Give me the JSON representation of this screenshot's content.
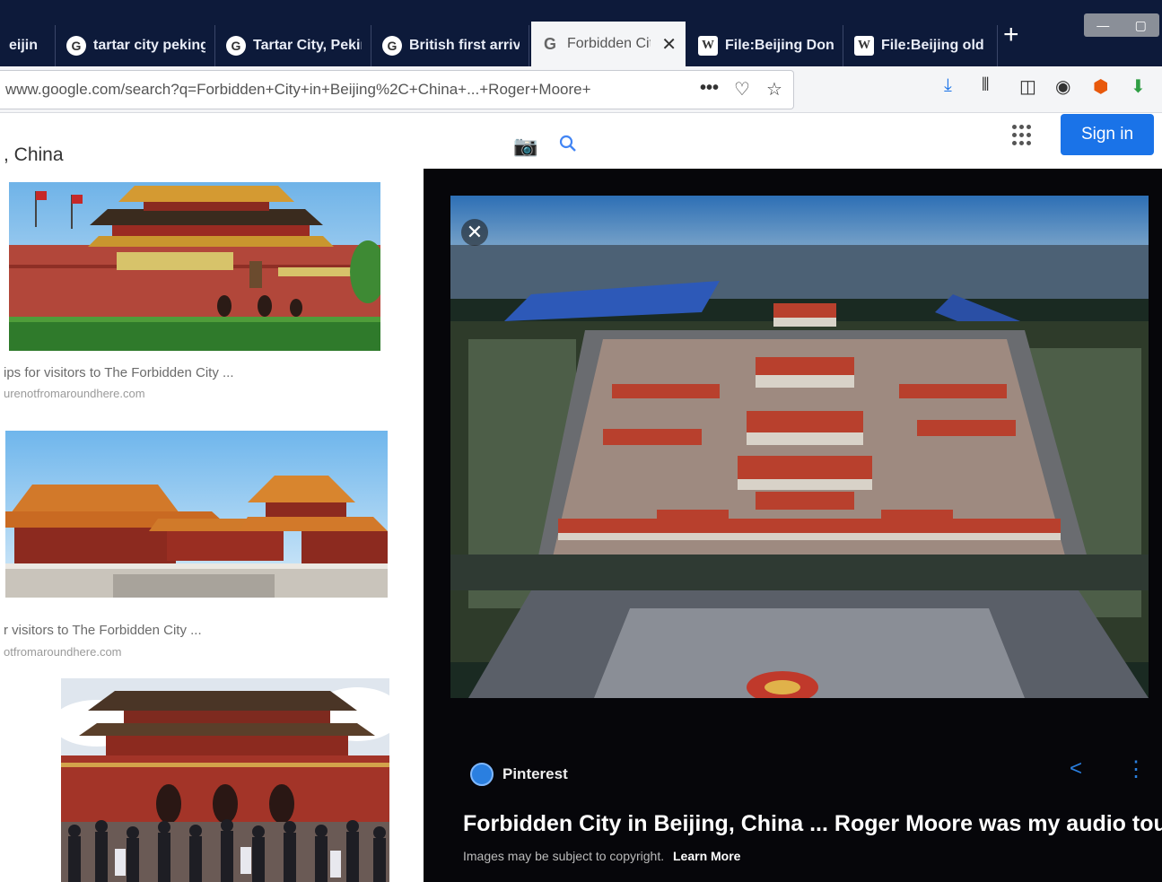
{
  "browser": {
    "tabs": [
      {
        "label": "eijin",
        "favicon": "google-icon",
        "active": false
      },
      {
        "label": "tartar city peking",
        "favicon": "google-icon",
        "active": false
      },
      {
        "label": "Tartar City, Pekin",
        "favicon": "google-icon",
        "active": false
      },
      {
        "label": "British first arrive",
        "favicon": "google-icon",
        "active": false
      },
      {
        "label": "Forbidden Cit",
        "favicon": "google-icon",
        "active": true
      },
      {
        "label": "File:Beijing Dong",
        "favicon": "wikipedia-icon",
        "active": false
      },
      {
        "label": "File:Beijing old c",
        "favicon": "wikipedia-icon",
        "active": false
      }
    ],
    "new_tab": "+",
    "url": "www.google.com/search?q=Forbidden+City+in+Beijing%2C+China+...+Roger+Moore+"
  },
  "search": {
    "query_fragment": ", China",
    "sign_in": "Sign in"
  },
  "results": [
    {
      "caption": "ips for visitors to The Forbidden City ...",
      "source": "urenotfromaroundhere.com"
    },
    {
      "caption": "r visitors to The Forbidden City ...",
      "source": "otfromaroundhere.com"
    }
  ],
  "preview": {
    "site": "Pinterest",
    "title": "Forbidden City in Beijing, China ... Roger Moore was my audio tour",
    "copyright": "Images may be subject to copyright.",
    "learn_more": "Learn More"
  },
  "colors": {
    "tab_bar": "#0d1a3a",
    "accent_blue": "#1a73e8",
    "panel_bg": "#06060a"
  }
}
